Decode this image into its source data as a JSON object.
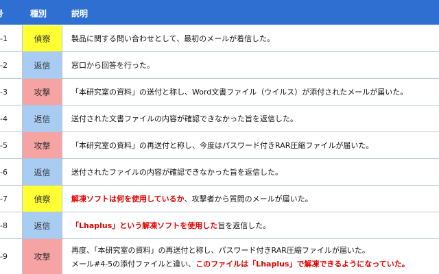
{
  "header": {
    "no": "号",
    "type": "種別",
    "desc": "説明"
  },
  "rows": [
    {
      "no": "4-1",
      "type": "偵察",
      "line1a": "製品に関する問い合わせとして、最初のメールが着信した。"
    },
    {
      "no": "4-2",
      "type": "返信",
      "line1a": "窓口から回答を行った。"
    },
    {
      "no": "4-3",
      "type": "攻撃",
      "line1a": "「本研究室の資料」の送付と称し、Word文書ファイル（ウイルス）が添付されたメールが届いた。"
    },
    {
      "no": "4-4",
      "type": "返信",
      "line1a": "送付された文書ファイルの内容が確認できなかった旨を返信した。"
    },
    {
      "no": "4-5",
      "type": "攻撃",
      "line1a": "「本研究室の資料」の再送付と称し、今度はパスワード付きRAR圧縮ファイルが届いた。"
    },
    {
      "no": "4-6",
      "type": "返信",
      "line1a": "送付されたファイルの内容が確認できなかった旨を返信した。"
    },
    {
      "no": "4-7",
      "type": "偵察",
      "line1_red": "解凍ソフトは何を使用しているか",
      "line1a": "、攻撃者から質問のメールが届いた。"
    },
    {
      "no": "4-8",
      "type": "返信",
      "line1_red": "「Lhaplus」という解凍ソフトを使用した",
      "line1a": "旨を返信した。"
    },
    {
      "no": "4-9",
      "type": "攻撃",
      "line1a": "再度、「本研究室の資料」の再送付と称し、パスワード付きRAR圧縮ファイルが届いた。",
      "line2a": "メール#4-5の添付ファイルと違い、",
      "line2_red": "このファイルは「Lhaplus」で解凍できるようになっていた。"
    }
  ],
  "type_colors": {
    "偵察": "#ffff33",
    "返信": "#a9ccf2",
    "攻撃": "#f6a3a3"
  },
  "header_color": "#2e6fd1"
}
